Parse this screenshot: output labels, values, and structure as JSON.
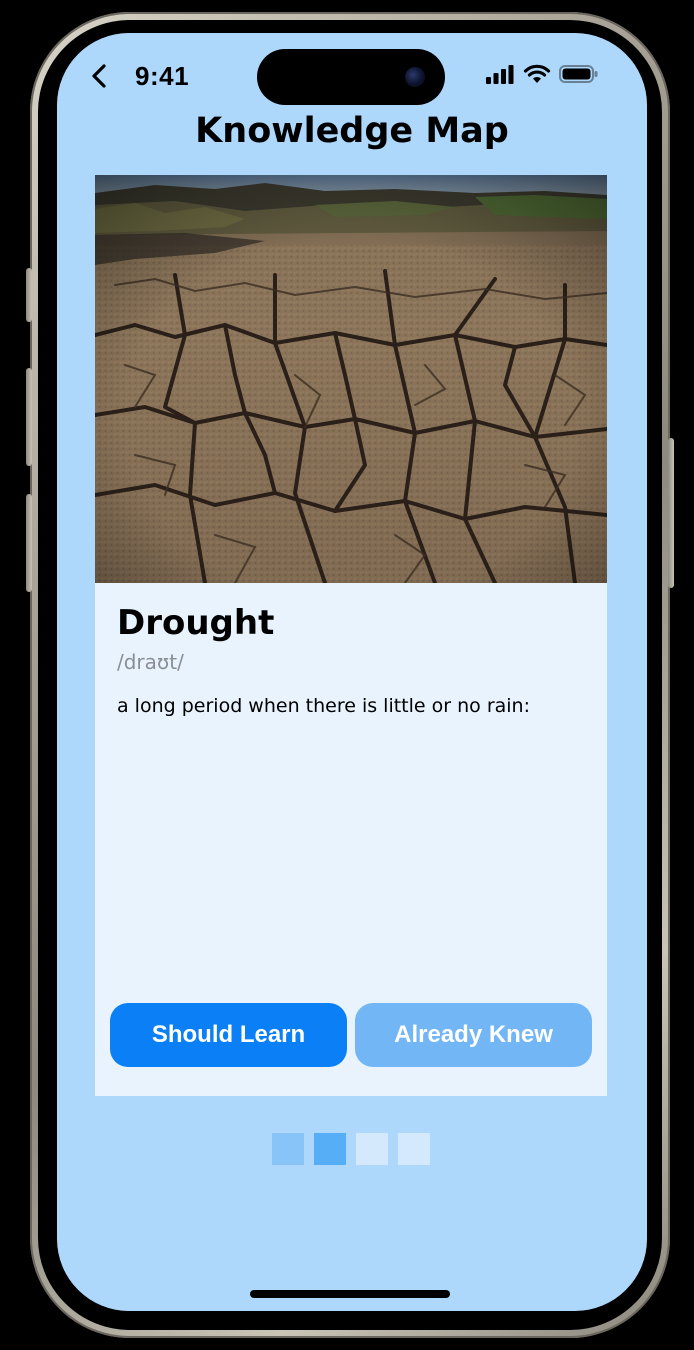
{
  "status_bar": {
    "time": "9:41"
  },
  "header": {
    "title": "Knowledge Map"
  },
  "card": {
    "image_description_icon": "cracked-dry-earth-photo",
    "word": "Drought",
    "pronunciation": "/draʊt/",
    "definition": "a long period when there is little or no rain:"
  },
  "actions": {
    "should_learn_label": "Should Learn",
    "already_knew_label": "Already Knew"
  },
  "pager": {
    "dots": [
      {
        "state": "visited"
      },
      {
        "state": "active"
      },
      {
        "state": "upcoming"
      },
      {
        "state": "upcoming"
      }
    ]
  },
  "colors": {
    "screen_background": "#add8fb",
    "card_background": "#e8f3fd",
    "primary_button": "#0a7ff6",
    "secondary_button": "#72b6f6",
    "pager_visited": "#88c4f8",
    "pager_active": "#55aef6",
    "pager_upcoming": "#d4e9fc"
  }
}
